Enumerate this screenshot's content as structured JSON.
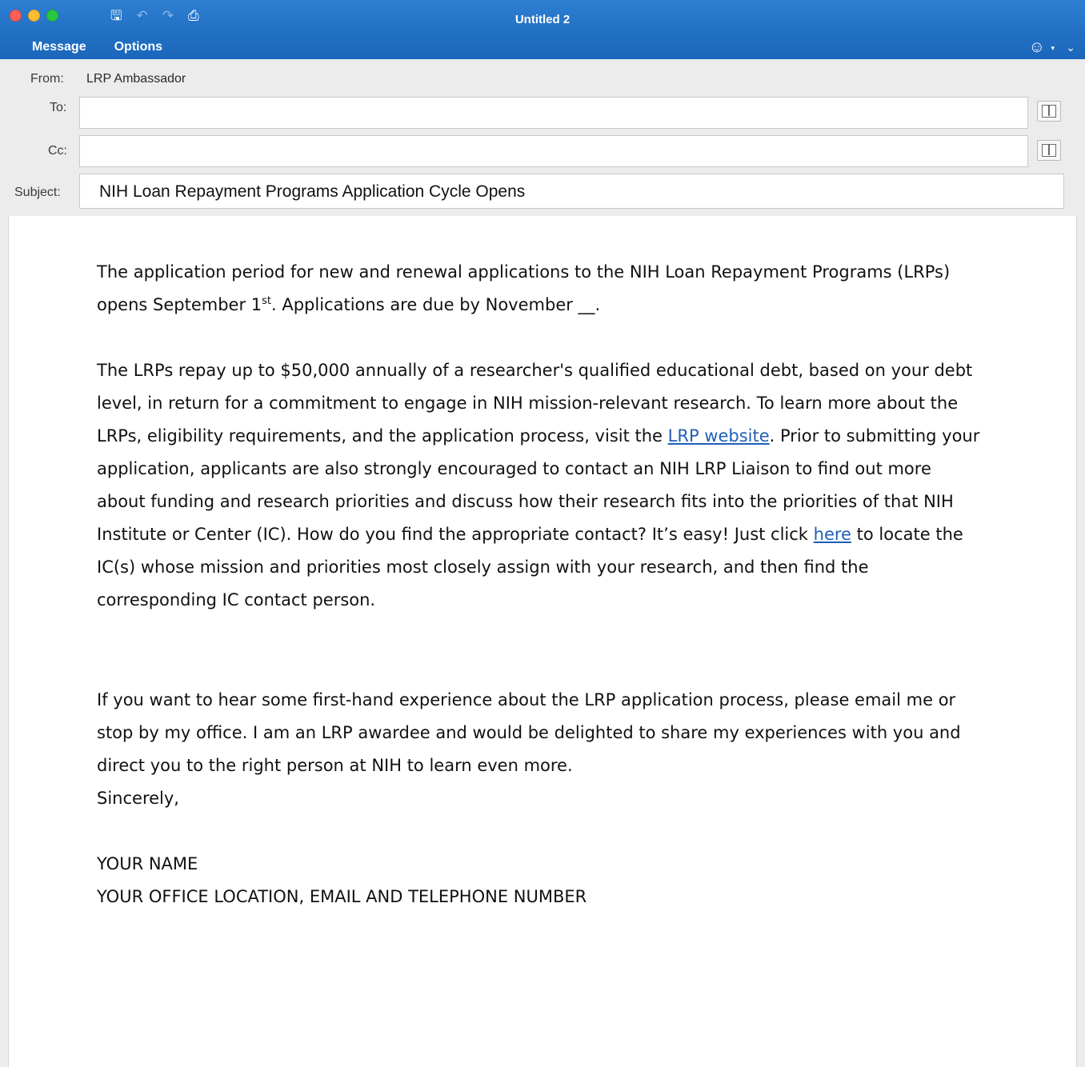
{
  "window": {
    "title": "Untitled 2",
    "tabs": [
      "Message",
      "Options"
    ]
  },
  "toolbar": {
    "icons": [
      "save-icon",
      "undo-icon",
      "redo-icon",
      "print-icon",
      "emoji-icon",
      "collapse-ribbon-icon"
    ]
  },
  "header": {
    "from_label": "From:",
    "from_value": "LRP Ambassador",
    "to_label": "To:",
    "to_value": "",
    "cc_label": "Cc:",
    "cc_value": "",
    "subject_label": "Subject:",
    "subject_value": "NIH Loan Repayment Programs Application Cycle Opens"
  },
  "body": {
    "p1_a": "The application period for new and renewal applications to the NIH Loan Repayment Programs (LRPs) opens September 1",
    "p1_sup": "st",
    "p1_b": ". Applications are due by November __.",
    "p2_a": "The LRPs repay up to $50,000 annually of a researcher's qualified educational debt, based on your debt level, in return for a commitment to engage in NIH mission-relevant research. To learn more about the LRPs, eligibility requirements, and the application process, visit the ",
    "p2_link1": "LRP website",
    "p2_b": ". Prior to submitting your application, applicants are also strongly encouraged to contact an NIH LRP Liaison to find out more about funding and research priorities and discuss how their research fits into the priorities of that NIH Institute or Center (IC). How do you find the appropriate contact? It’s easy! Just click ",
    "p2_link2": "here",
    "p2_c": " to locate the IC(s) whose mission and priorities most closely assign with your research, and then find the corresponding IC contact person.",
    "p3": "If you want to hear some first-hand experience about the LRP application process, please email me or stop by my office. I am an LRP awardee and would be delighted to share my experiences with you and direct you to the right person at NIH to learn even more.",
    "closing": "Sincerely,",
    "sig_name": "YOUR NAME",
    "sig_details": "YOUR OFFICE LOCATION, EMAIL AND TELEPHONE NUMBER"
  },
  "colors": {
    "ribbon": "#1e6fc4",
    "link": "#1f5fb8"
  }
}
